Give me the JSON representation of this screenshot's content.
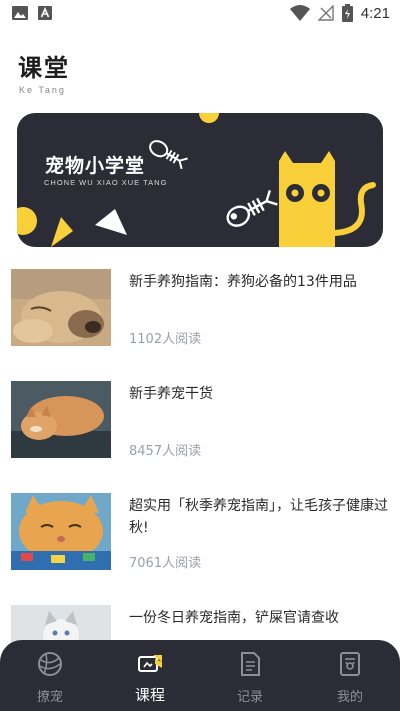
{
  "status_bar": {
    "time": "4:21"
  },
  "header": {
    "title": "课堂",
    "subtitle": "Ke Tang"
  },
  "banner": {
    "title": "宠物小学堂",
    "subtitle": "CHONE WU XIAO XUE TANG"
  },
  "articles": [
    {
      "title": "新手养狗指南：养狗必备的13件用品",
      "reads": "1102人阅读",
      "thumb": "golden-retriever-photo"
    },
    {
      "title": "新手养宠干货",
      "reads": "8457人阅读",
      "thumb": "sleeping-cat-photo"
    },
    {
      "title": "超实用「秋季养宠指南」，让毛孩子健康过秋!",
      "reads": "7061人阅读",
      "thumb": "orange-cat-photo"
    },
    {
      "title": "一份冬日养宠指南，铲屎官请查收",
      "reads": "",
      "thumb": "white-cat-photo"
    }
  ],
  "tabbar": {
    "items": [
      {
        "label": "撩宠",
        "icon": "yarn-ball-icon",
        "active": false
      },
      {
        "label": "课程",
        "icon": "course-icon",
        "active": true
      },
      {
        "label": "记录",
        "icon": "document-icon",
        "active": false
      },
      {
        "label": "我的",
        "icon": "profile-card-icon",
        "active": false
      }
    ]
  },
  "colors": {
    "dark": "#2b2c36",
    "accent": "#f9cf3a",
    "muted": "#9a9fa8"
  }
}
